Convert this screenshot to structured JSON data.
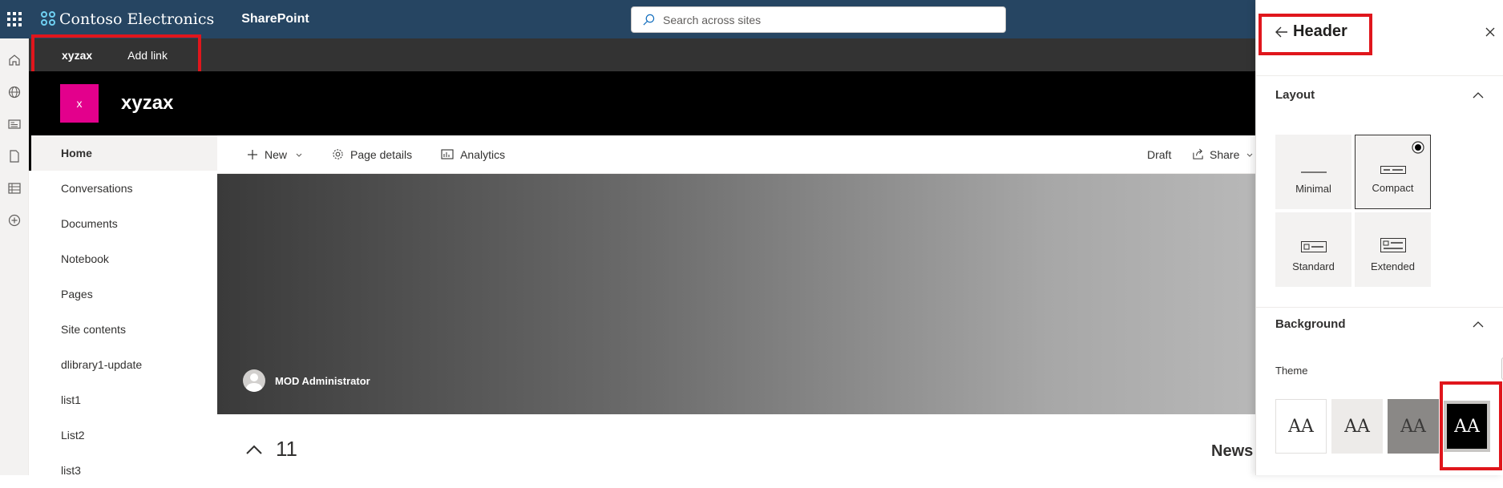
{
  "suitebar": {
    "brand": "Contoso Electronics",
    "app": "SharePoint",
    "search_placeholder": "Search across sites"
  },
  "hubnav": {
    "items": [
      {
        "label": "xyzax"
      },
      {
        "label": "Add link"
      }
    ]
  },
  "site": {
    "logo_letter": "x",
    "title": "xyzax"
  },
  "sidenav": {
    "items": [
      {
        "label": "Home"
      },
      {
        "label": "Conversations"
      },
      {
        "label": "Documents"
      },
      {
        "label": "Notebook"
      },
      {
        "label": "Pages"
      },
      {
        "label": "Site contents"
      },
      {
        "label": "dlibrary1-update"
      },
      {
        "label": "list1"
      },
      {
        "label": "List2"
      },
      {
        "label": "list3"
      }
    ]
  },
  "commandbar": {
    "new": "New",
    "page_details": "Page details",
    "analytics": "Analytics",
    "draft": "Draft",
    "share": "Share"
  },
  "hero": {
    "author": "MOD Administrator"
  },
  "page": {
    "count": "11",
    "news_heading": "News"
  },
  "panel": {
    "title": "Header",
    "layout_heading": "Layout",
    "layout_options": [
      {
        "label": "Minimal"
      },
      {
        "label": "Compact"
      },
      {
        "label": "Standard"
      },
      {
        "label": "Extended"
      }
    ],
    "selected_layout": "Compact",
    "background_heading": "Background",
    "theme_label": "Theme",
    "theme_glyph": "AA",
    "theme_colors": [
      "#ffffff",
      "#f3f2f1",
      "#8a8886",
      "#000000"
    ]
  },
  "colors": {
    "suitebar": "#264562",
    "hubnav": "#333333",
    "site_header": "#000000",
    "site_logo": "#e3008c",
    "highlight": "#e0161c"
  }
}
